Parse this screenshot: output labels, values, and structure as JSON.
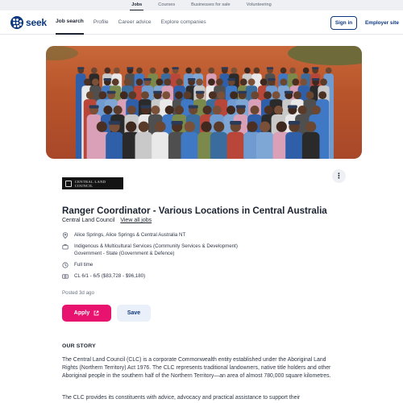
{
  "top_strip": {
    "items": [
      "Jobs",
      "Courses",
      "Businesses for sale",
      "Volunteering"
    ]
  },
  "nav": {
    "logo_text": "seek",
    "links": [
      "Job search",
      "Profile",
      "Career advice",
      "Explore companies"
    ],
    "sign_in": "Sign in",
    "employer_site": "Employer site"
  },
  "company_logo": {
    "text": "CENTRAL LAND COUNCIL"
  },
  "job": {
    "title": "Ranger Coordinator - Various Locations in Central Australia",
    "company": "Central Land Council",
    "view_all_jobs": "View all jobs",
    "location": "Alice Springs, Alice Springs & Central Australia NT",
    "classification_line1": "Indigenous & Multicultural Services (Community Services & Development)",
    "classification_line2": "Government - State (Government & Defence)",
    "work_type": "Full time",
    "salary": "CL 6/1 - 6/5 ($83,728 - $96,180)",
    "posted": "Posted 3d ago",
    "apply_label": "Apply",
    "save_label": "Save"
  },
  "story": {
    "heading": "OUR STORY",
    "para1": "The Central Land Council (CLC) is a corporate Commonwealth entity established under the Aboriginal Land Rights (Northern Territory) Act 1976. The CLC represents traditional landowners, native title holders and other Aboriginal people in the southern half of the Northern Territory—an area of almost 780,000 square kilometres.",
    "para2": "The CLC provides its constituents with advice, advocacy and practical assistance to support their"
  },
  "colors": {
    "brand": "#0d3880",
    "apply": "#e8136e",
    "save_bg": "#eaf0f9"
  },
  "icons": {
    "location": "location-pin-icon",
    "classification": "briefcase-icon",
    "work_type": "clock-icon",
    "salary": "money-icon",
    "external": "external-link-icon",
    "more": "more-options-icon"
  }
}
